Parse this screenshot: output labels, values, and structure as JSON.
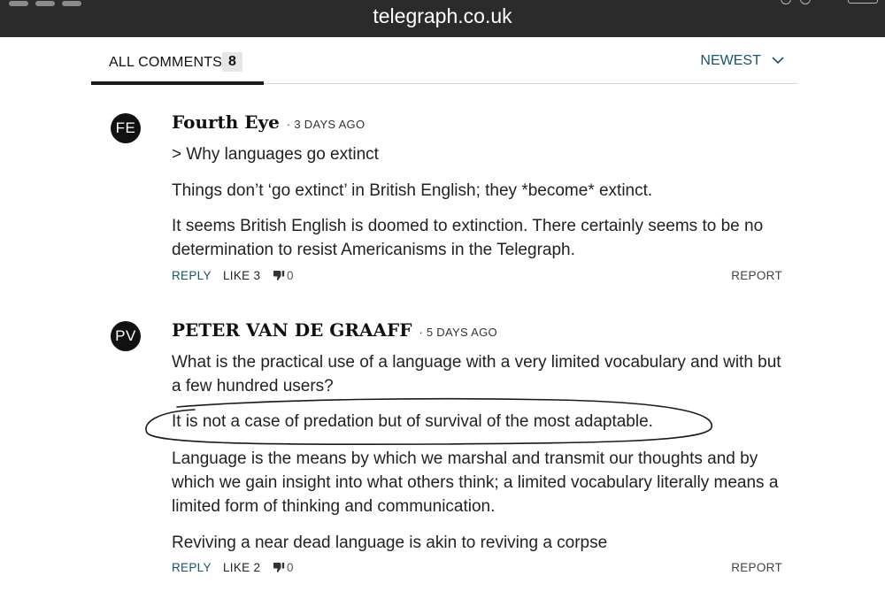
{
  "browser": {
    "domain": "telegraph.co.uk"
  },
  "tabs": {
    "all_label": "ALL COMMENTS",
    "count": "8",
    "sort_label": "NEWEST"
  },
  "comments": [
    {
      "initials": "FE",
      "author": "Fourth Eye",
      "time": "3 DAYS AGO",
      "paragraphs": [
        "> Why languages go extinct",
        "Things don’t ‘go extinct’ in British English; they *become* extinct.",
        "It seems British English is doomed to extinction. There certainly seems to be no determination to resist Americanisms in the Telegraph."
      ],
      "reply": "REPLY",
      "like": "LIKE 3",
      "dislike_count": "0",
      "report": "REPORT"
    },
    {
      "initials": "PV",
      "author": "PETER VAN DE GRAAFF",
      "time": "5 DAYS AGO",
      "paragraphs": [
        "What is the practical use of a language with a very limited vocabulary and with but a few hundred users?",
        "It is not a case of predation but of survival of the most adaptable.",
        "Language is the means by which we marshal and transmit our thoughts and by which we gain insight into what others think; a limited vocabulary literally means a limited form of thinking and communication.",
        "Reviving a near dead language is akin to reviving a corpse"
      ],
      "reply": "REPLY",
      "like": "LIKE 2",
      "dislike_count": "0",
      "report": "REPORT"
    }
  ],
  "icons": {
    "sort": "chevron-down-icon",
    "dislike": "thumbs-down-icon"
  },
  "colors": {
    "accent": "#17546b",
    "topbar": "#2b2b2b"
  }
}
